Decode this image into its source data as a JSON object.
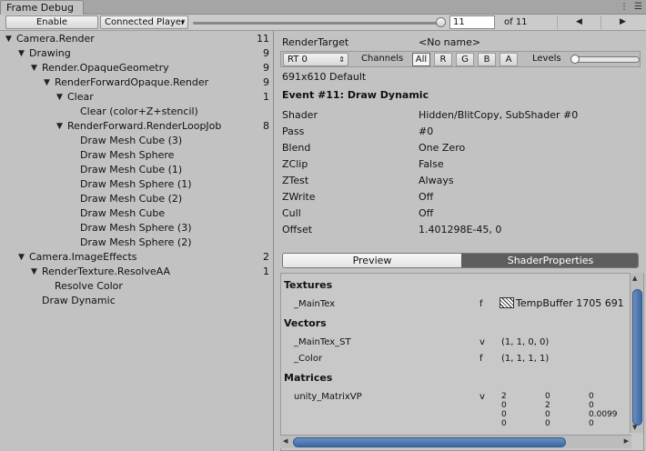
{
  "window": {
    "tab_title": "Frame Debug"
  },
  "toolbar": {
    "enable_label": "Enable",
    "player_dropdown": "Connected Player",
    "event_index": "11",
    "event_total": "of 11",
    "slider_fraction": 1.0
  },
  "tree": [
    {
      "label": "Camera.Render",
      "count": "11",
      "depth": 0,
      "expanded": true
    },
    {
      "label": "Drawing",
      "count": "9",
      "depth": 1,
      "expanded": true
    },
    {
      "label": "Render.OpaqueGeometry",
      "count": "9",
      "depth": 2,
      "expanded": true
    },
    {
      "label": "RenderForwardOpaque.Render",
      "count": "9",
      "depth": 3,
      "expanded": true
    },
    {
      "label": "Clear",
      "count": "1",
      "depth": 4,
      "expanded": true
    },
    {
      "label": "Clear (color+Z+stencil)",
      "count": "",
      "depth": 5,
      "expanded": null
    },
    {
      "label": "RenderForward.RenderLoopJob",
      "count": "8",
      "depth": 4,
      "expanded": true
    },
    {
      "label": "Draw Mesh Cube (3)",
      "count": "",
      "depth": 5,
      "expanded": null
    },
    {
      "label": "Draw Mesh Sphere",
      "count": "",
      "depth": 5,
      "expanded": null
    },
    {
      "label": "Draw Mesh Cube (1)",
      "count": "",
      "depth": 5,
      "expanded": null
    },
    {
      "label": "Draw Mesh Sphere (1)",
      "count": "",
      "depth": 5,
      "expanded": null
    },
    {
      "label": "Draw Mesh Cube (2)",
      "count": "",
      "depth": 5,
      "expanded": null
    },
    {
      "label": "Draw Mesh Cube",
      "count": "",
      "depth": 5,
      "expanded": null
    },
    {
      "label": "Draw Mesh Sphere (3)",
      "count": "",
      "depth": 5,
      "expanded": null
    },
    {
      "label": "Draw Mesh Sphere (2)",
      "count": "",
      "depth": 5,
      "expanded": null
    },
    {
      "label": "Camera.ImageEffects",
      "count": "2",
      "depth": 1,
      "expanded": true
    },
    {
      "label": "RenderTexture.ResolveAA",
      "count": "1",
      "depth": 2,
      "expanded": true
    },
    {
      "label": "Resolve Color",
      "count": "",
      "depth": 3,
      "expanded": null
    },
    {
      "label": "Draw Dynamic",
      "count": "",
      "depth": 2,
      "expanded": null
    }
  ],
  "details": {
    "render_target_label": "RenderTarget",
    "render_target_value": "<No name>",
    "rt_dropdown": "RT 0",
    "channels_label": "Channels",
    "channels": [
      "All",
      "R",
      "G",
      "B",
      "A"
    ],
    "levels_label": "Levels",
    "resolution": "691x610 Default",
    "event_title": "Event #11: Draw Dynamic",
    "rows": [
      {
        "key": "Shader",
        "value": "Hidden/BlitCopy, SubShader #0"
      },
      {
        "key": "Pass",
        "value": "#0"
      },
      {
        "key": "Blend",
        "value": "One Zero"
      },
      {
        "key": "ZClip",
        "value": "False"
      },
      {
        "key": "ZTest",
        "value": "Always"
      },
      {
        "key": "ZWrite",
        "value": "Off"
      },
      {
        "key": "Cull",
        "value": "Off"
      },
      {
        "key": "Offset",
        "value": "1.401298E-45, 0"
      }
    ],
    "tabs": {
      "preview": "Preview",
      "shader_properties": "ShaderProperties"
    }
  },
  "properties": {
    "textures_header": "Textures",
    "textures": [
      {
        "name": "_MainTex",
        "type": "f",
        "value": "TempBuffer 1705 691"
      }
    ],
    "vectors_header": "Vectors",
    "vectors": [
      {
        "name": "_MainTex_ST",
        "type": "v",
        "value": "(1, 1, 0, 0)"
      },
      {
        "name": "_Color",
        "type": "f",
        "value": "(1, 1, 1, 1)"
      }
    ],
    "matrices_header": "Matrices",
    "matrices": [
      {
        "name": "unity_MatrixVP",
        "type": "v",
        "rows": [
          [
            "2",
            "0",
            "0"
          ],
          [
            "0",
            "2",
            "0"
          ],
          [
            "0",
            "0",
            "0.0099"
          ],
          [
            "0",
            "0",
            "0"
          ]
        ]
      }
    ]
  },
  "colors": {
    "selected_tab": "#5e5e5e",
    "scroll_thumb": "#3b6aa6"
  }
}
